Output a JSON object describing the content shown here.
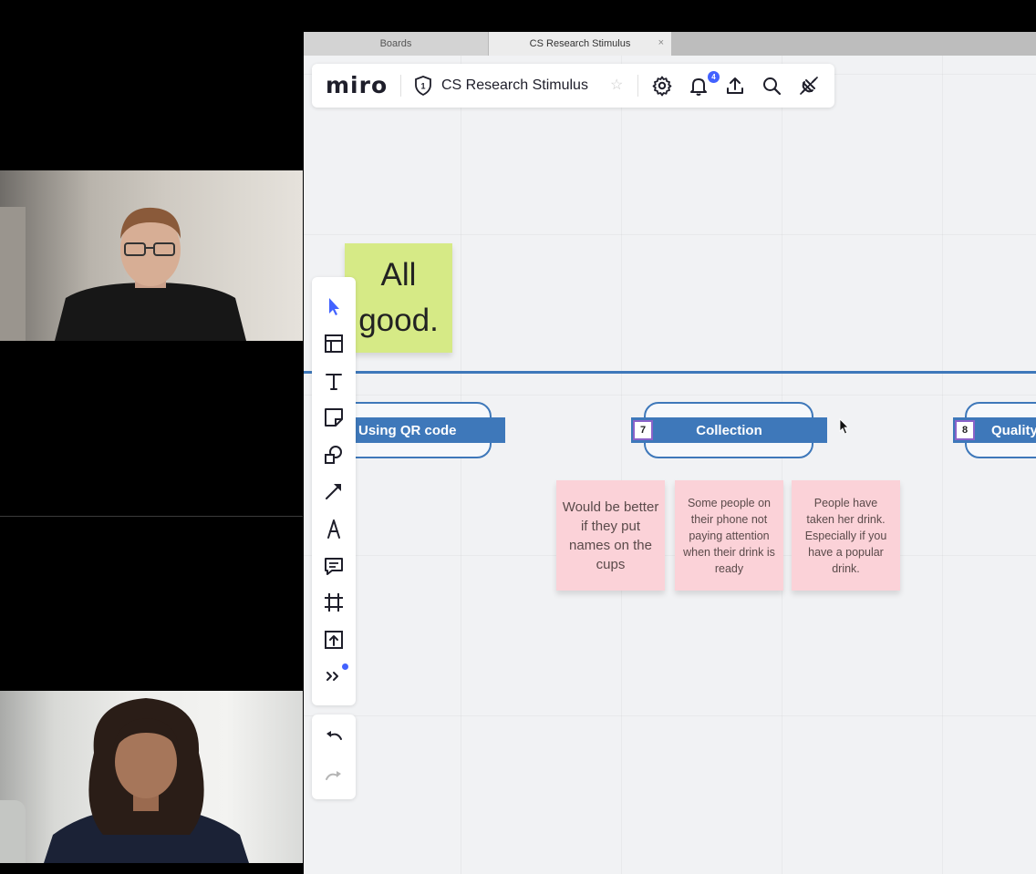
{
  "tabs": {
    "boards": "Boards",
    "active": "CS Research Stimulus",
    "close": "×"
  },
  "toolbar": {
    "logo": "miro",
    "board_title": "CS Research Stimulus",
    "shield_number": "1",
    "notification_count": "4"
  },
  "stages": [
    {
      "number": "",
      "label": "Using QR code"
    },
    {
      "number": "7",
      "label": "Collection"
    },
    {
      "number": "8",
      "label": "Quality"
    }
  ],
  "stickies": {
    "green": "All good.",
    "pink": [
      "Would be better if they put names on the cups",
      "Some people on their phone not paying attention when their drink is ready",
      "People have taken her drink. Especially if you have a popular drink."
    ]
  },
  "colors": {
    "accent": "#4262ff",
    "stage_blue": "#3e78ba",
    "sticky_green": "#d6ea86",
    "sticky_pink": "#fbd2d8"
  }
}
